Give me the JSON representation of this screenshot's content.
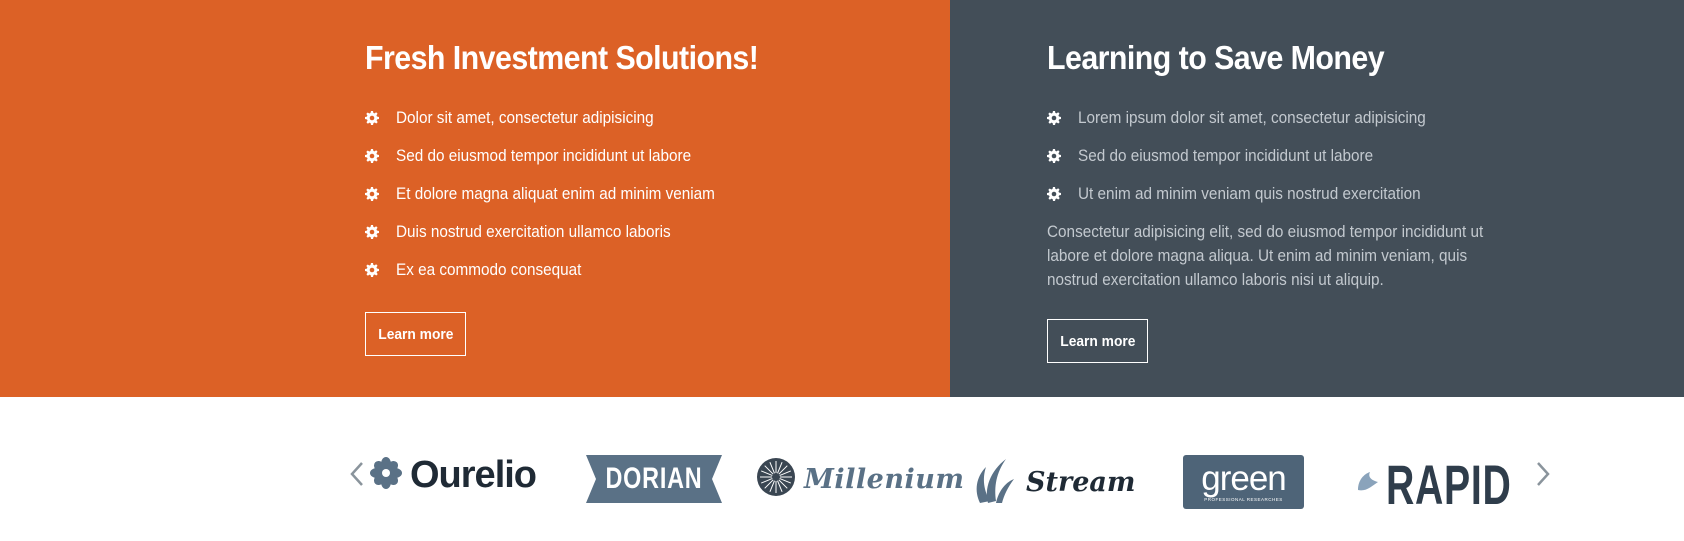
{
  "left_panel": {
    "title": "Fresh Investment Solutions!",
    "items": [
      "Dolor sit amet, consectetur adipisicing",
      "Sed do eiusmod tempor incididunt ut labore",
      "Et dolore magna aliquat enim ad minim veniam",
      "Duis nostrud exercitation ullamco laboris",
      "Ex ea commodo consequat"
    ],
    "button_label": "Learn more",
    "background_color": "#dc6126",
    "bullet_icon": "gear-icon"
  },
  "right_panel": {
    "title": "Learning to Save Money",
    "items": [
      "Lorem ipsum dolor sit amet, consectetur adipisicing",
      "Sed do eiusmod tempor incididunt ut labore",
      "Ut enim ad minim veniam quis nostrud exercitation"
    ],
    "paragraph": "Consectetur adipisicing elit, sed do eiusmod tempor incididunt ut labore et dolore magna aliqua. Ut enim ad minim veniam, quis nostrud exercitation ullamco laboris nisi ut aliquip.",
    "button_label": "Learn more",
    "background_color": "#434e58",
    "bullet_icon": "gear-icon"
  },
  "partners": {
    "prev_icon": "chevron-left-icon",
    "next_icon": "chevron-right-icon",
    "logos": {
      "ourelio": "Ourelio",
      "dorian": "DORIAN",
      "millenium": "Millenium",
      "stream": "Stream",
      "green": "green",
      "green_tagline": "PROFESSIONAL RESEARCHES",
      "rapid": "RAPID"
    }
  }
}
